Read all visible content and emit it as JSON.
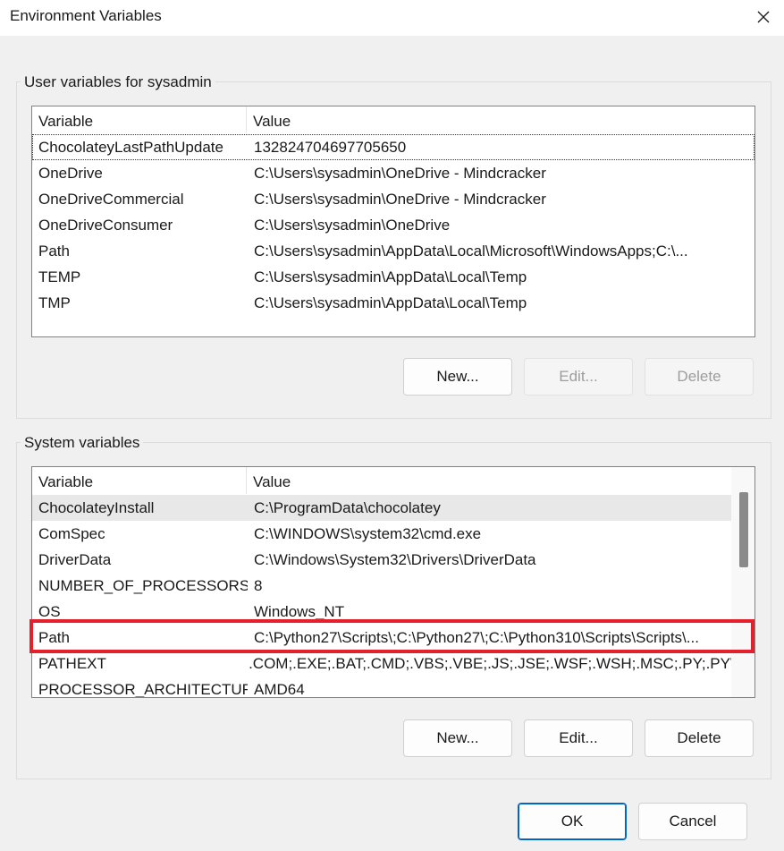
{
  "window": {
    "title": "Environment Variables",
    "close_icon": "close-icon"
  },
  "user_vars": {
    "label": "User variables for sysadmin",
    "columns": {
      "variable": "Variable",
      "value": "Value"
    },
    "rows": [
      {
        "name": "ChocolateyLastPathUpdate",
        "value": "132824704697705650"
      },
      {
        "name": "OneDrive",
        "value": "C:\\Users\\sysadmin\\OneDrive - Mindcracker"
      },
      {
        "name": "OneDriveCommercial",
        "value": "C:\\Users\\sysadmin\\OneDrive - Mindcracker"
      },
      {
        "name": "OneDriveConsumer",
        "value": "C:\\Users\\sysadmin\\OneDrive"
      },
      {
        "name": "Path",
        "value": "C:\\Users\\sysadmin\\AppData\\Local\\Microsoft\\WindowsApps;C:\\..."
      },
      {
        "name": "TEMP",
        "value": "C:\\Users\\sysadmin\\AppData\\Local\\Temp"
      },
      {
        "name": "TMP",
        "value": "C:\\Users\\sysadmin\\AppData\\Local\\Temp"
      }
    ],
    "buttons": {
      "new": "New...",
      "edit": "Edit...",
      "delete": "Delete"
    }
  },
  "system_vars": {
    "label": "System variables",
    "columns": {
      "variable": "Variable",
      "value": "Value"
    },
    "rows": [
      {
        "name": "ChocolateyInstall",
        "value": "C:\\ProgramData\\chocolatey"
      },
      {
        "name": "ComSpec",
        "value": "C:\\WINDOWS\\system32\\cmd.exe"
      },
      {
        "name": "DriverData",
        "value": "C:\\Windows\\System32\\Drivers\\DriverData"
      },
      {
        "name": "NUMBER_OF_PROCESSORS",
        "value": "8"
      },
      {
        "name": "OS",
        "value": "Windows_NT"
      },
      {
        "name": "Path",
        "value": "C:\\Python27\\Scripts\\;C:\\Python27\\;C:\\Python310\\Scripts\\Scripts\\..."
      },
      {
        "name": "PATHEXT",
        "value": ".COM;.EXE;.BAT;.CMD;.VBS;.VBE;.JS;.JSE;.WSF;.WSH;.MSC;.PY;.PYW"
      },
      {
        "name": "PROCESSOR_ARCHITECTURE",
        "value": "AMD64"
      }
    ],
    "buttons": {
      "new": "New...",
      "edit": "Edit...",
      "delete": "Delete"
    }
  },
  "footer": {
    "ok": "OK",
    "cancel": "Cancel"
  },
  "colors": {
    "highlight": "#e3202b",
    "primary_border": "#0067c0"
  }
}
